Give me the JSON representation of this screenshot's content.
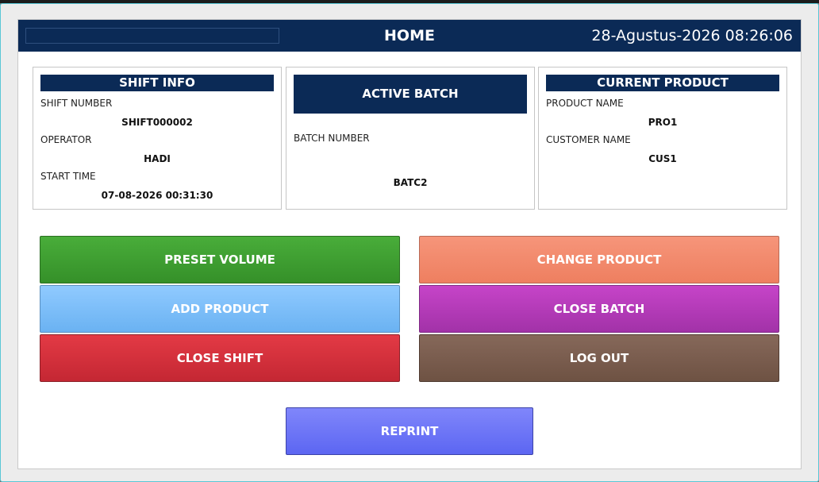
{
  "header": {
    "title": "HOME",
    "datetime": "28-Agustus-2026 08:26:06"
  },
  "shift_info": {
    "title": "SHIFT INFO",
    "shift_number_label": "SHIFT NUMBER",
    "shift_number": "SHIFT000002",
    "operator_label": "OPERATOR",
    "operator": "HADI",
    "start_time_label": "START TIME",
    "start_time": "07-08-2026 00:31:30"
  },
  "active_batch": {
    "title": "ACTIVE BATCH",
    "batch_number_label": "BATCH NUMBER",
    "batch_number": "BATC2"
  },
  "current_product": {
    "title": "CURRENT PRODUCT",
    "product_name_label": "PRODUCT NAME",
    "product_name": "PRO1",
    "customer_name_label": "CUSTOMER NAME",
    "customer_name": "CUS1"
  },
  "buttons": {
    "preset_volume": "PRESET VOLUME",
    "change_product": "CHANGE PRODUCT",
    "add_product": "ADD PRODUCT",
    "close_batch": "CLOSE BATCH",
    "close_shift": "CLOSE SHIFT",
    "log_out": "LOG OUT",
    "reprint": "REPRINT"
  },
  "colors": {
    "header": "#0b2a56",
    "preset_volume": "#3f9f32",
    "change_product": "#f28a6c",
    "add_product": "#7dbef8",
    "close_batch": "#b23cb8",
    "close_shift": "#d4303d",
    "log_out": "#7a5c4b",
    "reprint": "#6a72f6"
  }
}
